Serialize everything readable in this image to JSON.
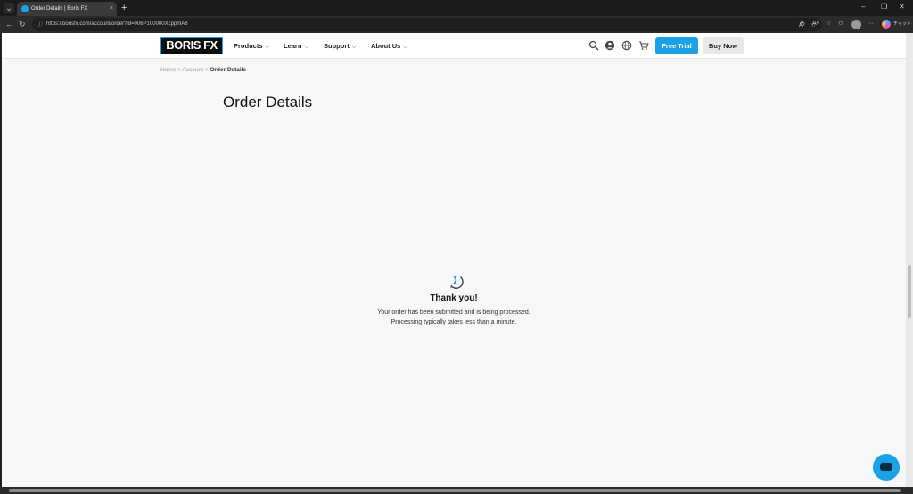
{
  "browser": {
    "tab": {
      "title": "Order Details | Boris FX",
      "close": "×"
    },
    "new_tab": "+",
    "tab_list": "⌄",
    "window": {
      "minimize": "–",
      "restore": "❐",
      "close": "✕"
    },
    "nav": {
      "back": "←",
      "reload": "↻"
    },
    "url": "https://borisfx.com/account/order?id=006P100000XcpphIA8",
    "url_info_icon": "ⓘ",
    "copilot_label": "チャット"
  },
  "header": {
    "logo": "BORIS FX",
    "menu": [
      {
        "label": "Products"
      },
      {
        "label": "Learn"
      },
      {
        "label": "Support"
      },
      {
        "label": "About Us"
      }
    ],
    "free_trial": "Free Trial",
    "buy_now": "Buy Now"
  },
  "breadcrumb": {
    "home": "Home",
    "account": "Account",
    "current": "Order Details",
    "separator": ">"
  },
  "page": {
    "title": "Order Details",
    "thanks": "Thank you!",
    "message_line1": "Your order has been submitted and is being processed.",
    "message_line2": "Processing typically takes less than a minute."
  },
  "colors": {
    "brand_blue": "#1aa1e6",
    "page_bg": "#f6f7f8"
  }
}
